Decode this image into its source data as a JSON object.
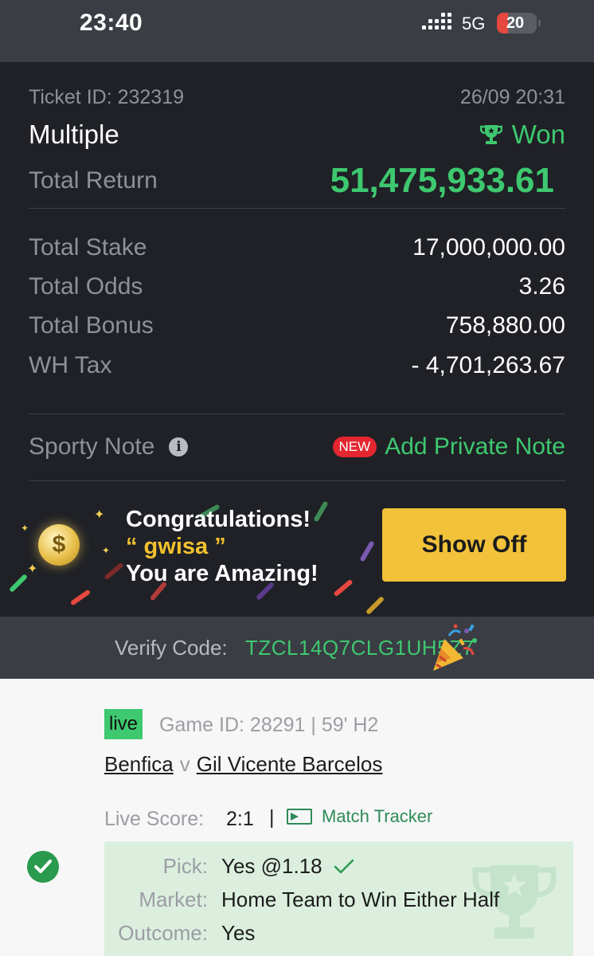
{
  "status_bar": {
    "time": "23:40",
    "network": "5G",
    "battery": "20",
    "battery_color": "#e5483f"
  },
  "ticket": {
    "id_label": "Ticket ID: 232319",
    "datetime": "26/09 20:31",
    "bet_type": "Multiple",
    "status": "Won",
    "status_icon": "trophy-icon",
    "total_return_label": "Total Return",
    "total_return_value": "51,475,933.61",
    "rows": [
      {
        "label": "Total Stake",
        "value": "17,000,000.00"
      },
      {
        "label": "Total Odds",
        "value": "3.26"
      },
      {
        "label": "Total Bonus",
        "value": "758,880.00"
      },
      {
        "label": "WH Tax",
        "value": "- 4,701,263.67"
      }
    ],
    "note_label": "Sporty Note",
    "new_badge": "NEW",
    "add_note_label": "Add Private Note",
    "accent_color": "#3ec86f"
  },
  "congrats": {
    "line1": "Congratulations!",
    "line2": "“ gwisa ”",
    "line3": "You are Amazing!",
    "button_label": "Show Off",
    "button_color": "#f2c23a"
  },
  "verify": {
    "label": "Verify Code:",
    "code": "TZCL14Q7CLG1UH5Z7"
  },
  "bet": {
    "live_label": "live",
    "game_info": "Game ID: 28291 | 59' H2",
    "home_team": "Benfica",
    "vs": "v",
    "away_team": "Gil Vicente Barcelos",
    "live_score_label": "Live Score:",
    "live_score": "2:1",
    "separator": "|",
    "match_tracker_label": "Match Tracker",
    "pick": {
      "pick_label": "Pick:",
      "pick_value": "Yes @1.18",
      "market_label": "Market:",
      "market_value": "Home Team to Win Either Half",
      "outcome_label": "Outcome:",
      "outcome_value": "Yes"
    }
  }
}
